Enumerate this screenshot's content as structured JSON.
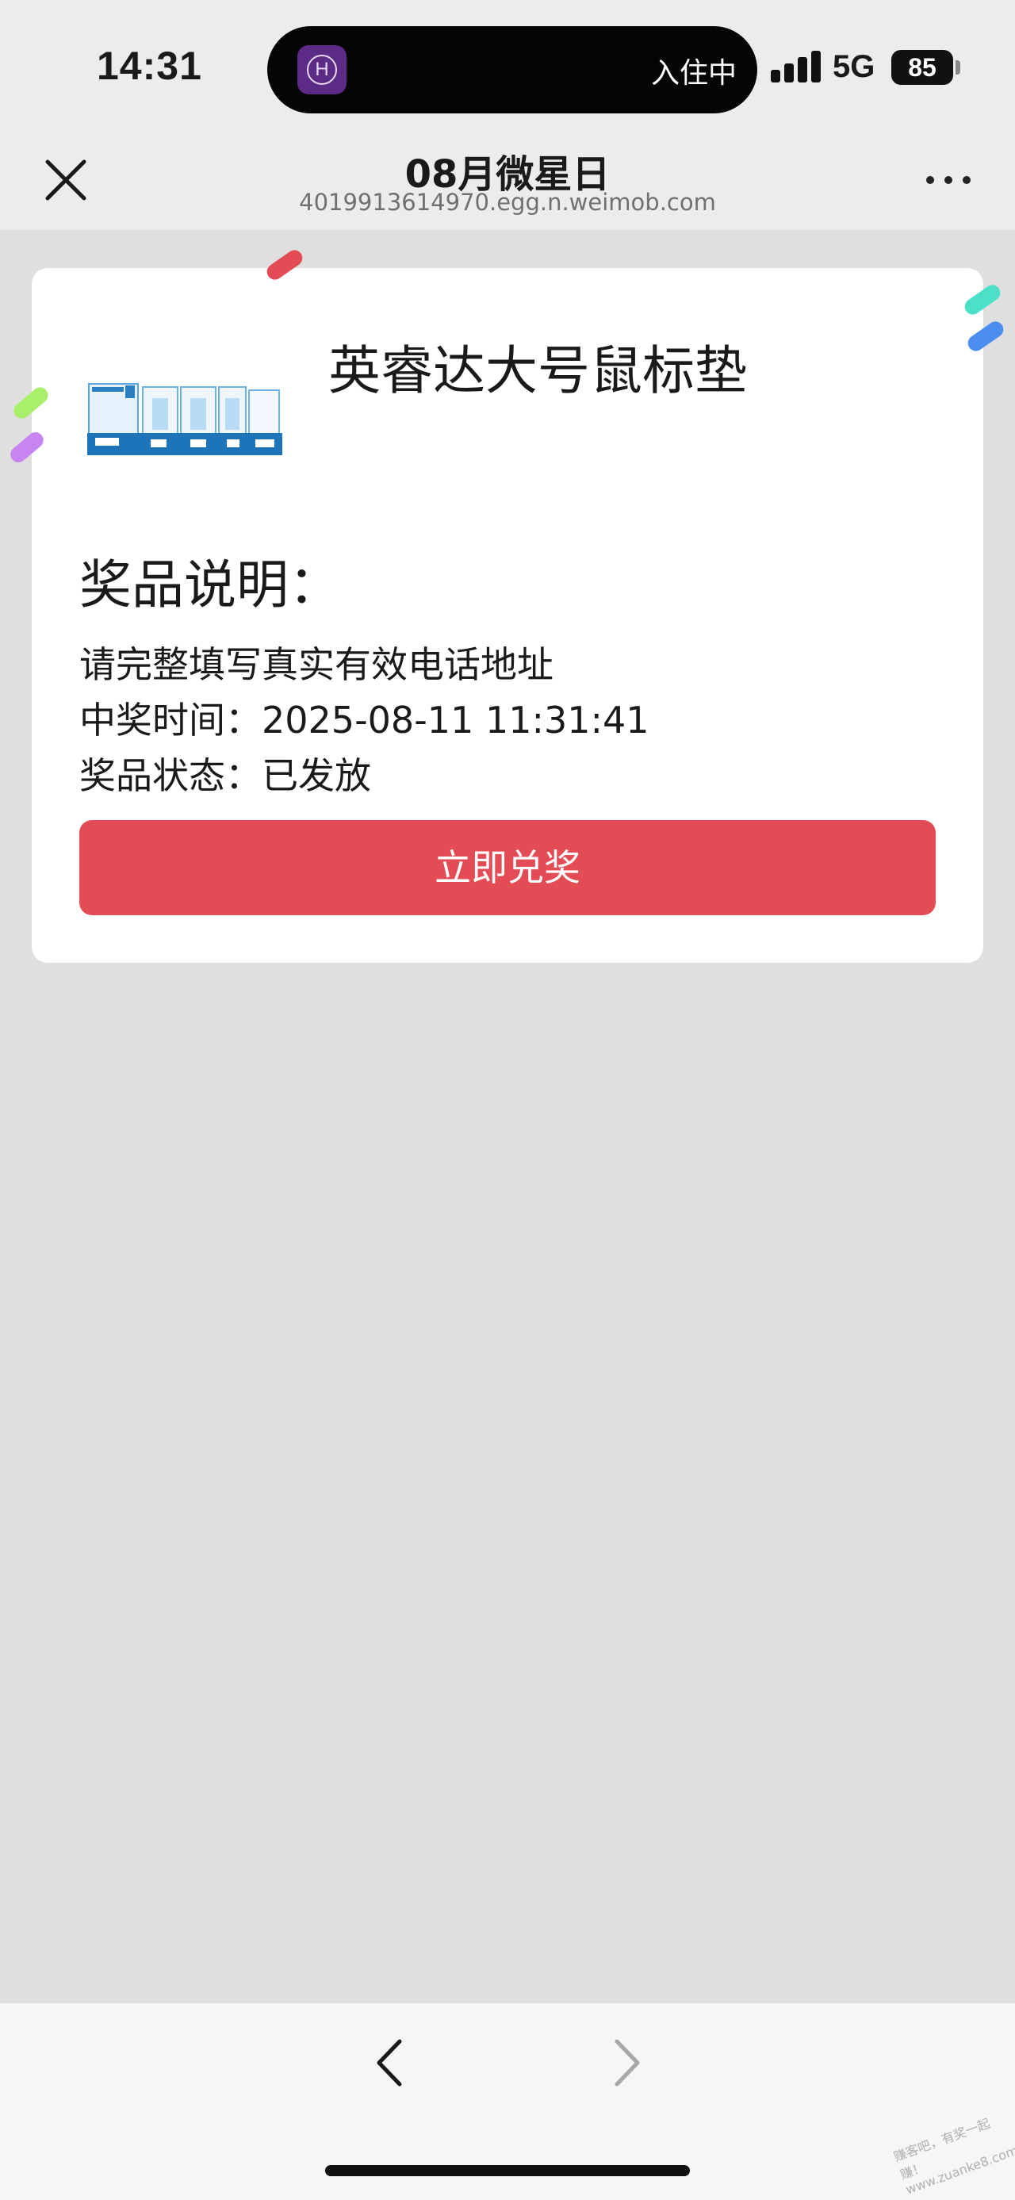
{
  "status_bar": {
    "time": "14:31",
    "island_app_letter": "H",
    "island_text": "入住中",
    "network": "5G",
    "battery": "85"
  },
  "nav": {
    "title": "08月微星日",
    "url": "4019913614970.egg.n.weimob.com",
    "close_icon": "close-icon",
    "more_icon": "more-icon"
  },
  "prize": {
    "name": "英睿达大号鼠标垫",
    "section_title": "奖品说明：",
    "lines": [
      "请完整填写真实有效电话地址",
      "中奖时间：2025-08-11 11:31:41",
      "奖品状态：已发放"
    ],
    "redeem_label": "立即兑奖"
  },
  "bottom": {
    "back_icon": "chevron-left-icon",
    "forward_icon": "chevron-right-icon",
    "watermark": "赚客吧，有奖一起赚！ www.zuanke8.com"
  },
  "colors": {
    "accent": "#e34b55",
    "background": "#e0dfe0",
    "header": "#ececec"
  }
}
